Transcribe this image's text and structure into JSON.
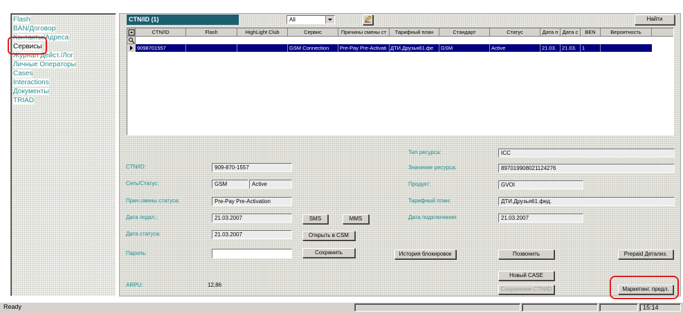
{
  "sidebar": {
    "items": [
      {
        "label": "Flash"
      },
      {
        "label": "BAN/Договор"
      },
      {
        "label": "Контакты/Адреса"
      },
      {
        "label": "Сервисы"
      },
      {
        "label": "Журнал Дейст./Лог"
      },
      {
        "label": "Личные Операторы"
      },
      {
        "label": "Cases"
      },
      {
        "label": "Interactions"
      },
      {
        "label": "Документы"
      },
      {
        "label": "TRIAD"
      }
    ]
  },
  "header": {
    "title": "CTN/ID (1)",
    "filter_value": "All",
    "find_button": "Найти"
  },
  "grid": {
    "columns": [
      "CTN/ID",
      "Flash",
      "HighLight Club",
      "Сервис",
      "Причины смены ст",
      "Тарифный план",
      "Стандарт",
      "Статус",
      "Дата п",
      "Дата с",
      "BEN",
      "Вероятность"
    ],
    "rows": [
      {
        "ctn": "9098701557",
        "flash": "",
        "highlight": "",
        "service": "GSM Connection",
        "reason": "Pre-Pay Pre-Activati",
        "tariff": "ДТИ.Друзья61.фе",
        "standard": "GSM",
        "status": "Active",
        "date_p": "21.03.",
        "date_s": "21.03.",
        "ben": "1",
        "probability": ""
      }
    ]
  },
  "details": {
    "ctn_label": "CTN/ID:",
    "ctn_value": "909-870-1557",
    "network_label": "Сеть/Статус:",
    "network_value": "GSM",
    "status_value": "Active",
    "reason_label": "Прич.смены статуса:",
    "reason_value": "Pre-Pay Pre-Activation",
    "conn_date_label": "Дата подкл.:",
    "conn_date_value": "21.03.2007",
    "status_date_label": "Дата статуса:",
    "status_date_value": "21.03.2007",
    "password_label": "Пароль:",
    "password_value": "",
    "arpu_label": "ARPU:",
    "arpu_value": "12,86",
    "resource_type_label": "Тип ресурса:",
    "resource_type_value": "ICC",
    "resource_value_label": "Значение ресурса:",
    "resource_value_value": "897019908021124276",
    "product_label": "Продукт:",
    "product_value": "GVOI",
    "tariff_label": "Тарифный план:",
    "tariff_value": "ДТИ.Друзья61.фед.",
    "connection_date_label": "Дата подключения:",
    "connection_date_value": "21.03.2007"
  },
  "buttons": {
    "sms": "SMS",
    "mms": "MMS",
    "open_csm": "Открыть в CSM",
    "save": "Сохранить",
    "block_history": "История блокировок",
    "call": "Позвонить",
    "prepaid": "Prepaid Детализ.",
    "new_case": "Новый CASE",
    "save_ctn": "Сохранение CTN/ID",
    "marketing": "Маркетинг. предл."
  },
  "statusbar": {
    "text": "Ready",
    "time": "15:14"
  },
  "colors": {
    "selection": "#000080",
    "label_teal": "#1b8d8d",
    "highlight_red": "#e21b1b",
    "title_bar": "#1c5f6f"
  }
}
